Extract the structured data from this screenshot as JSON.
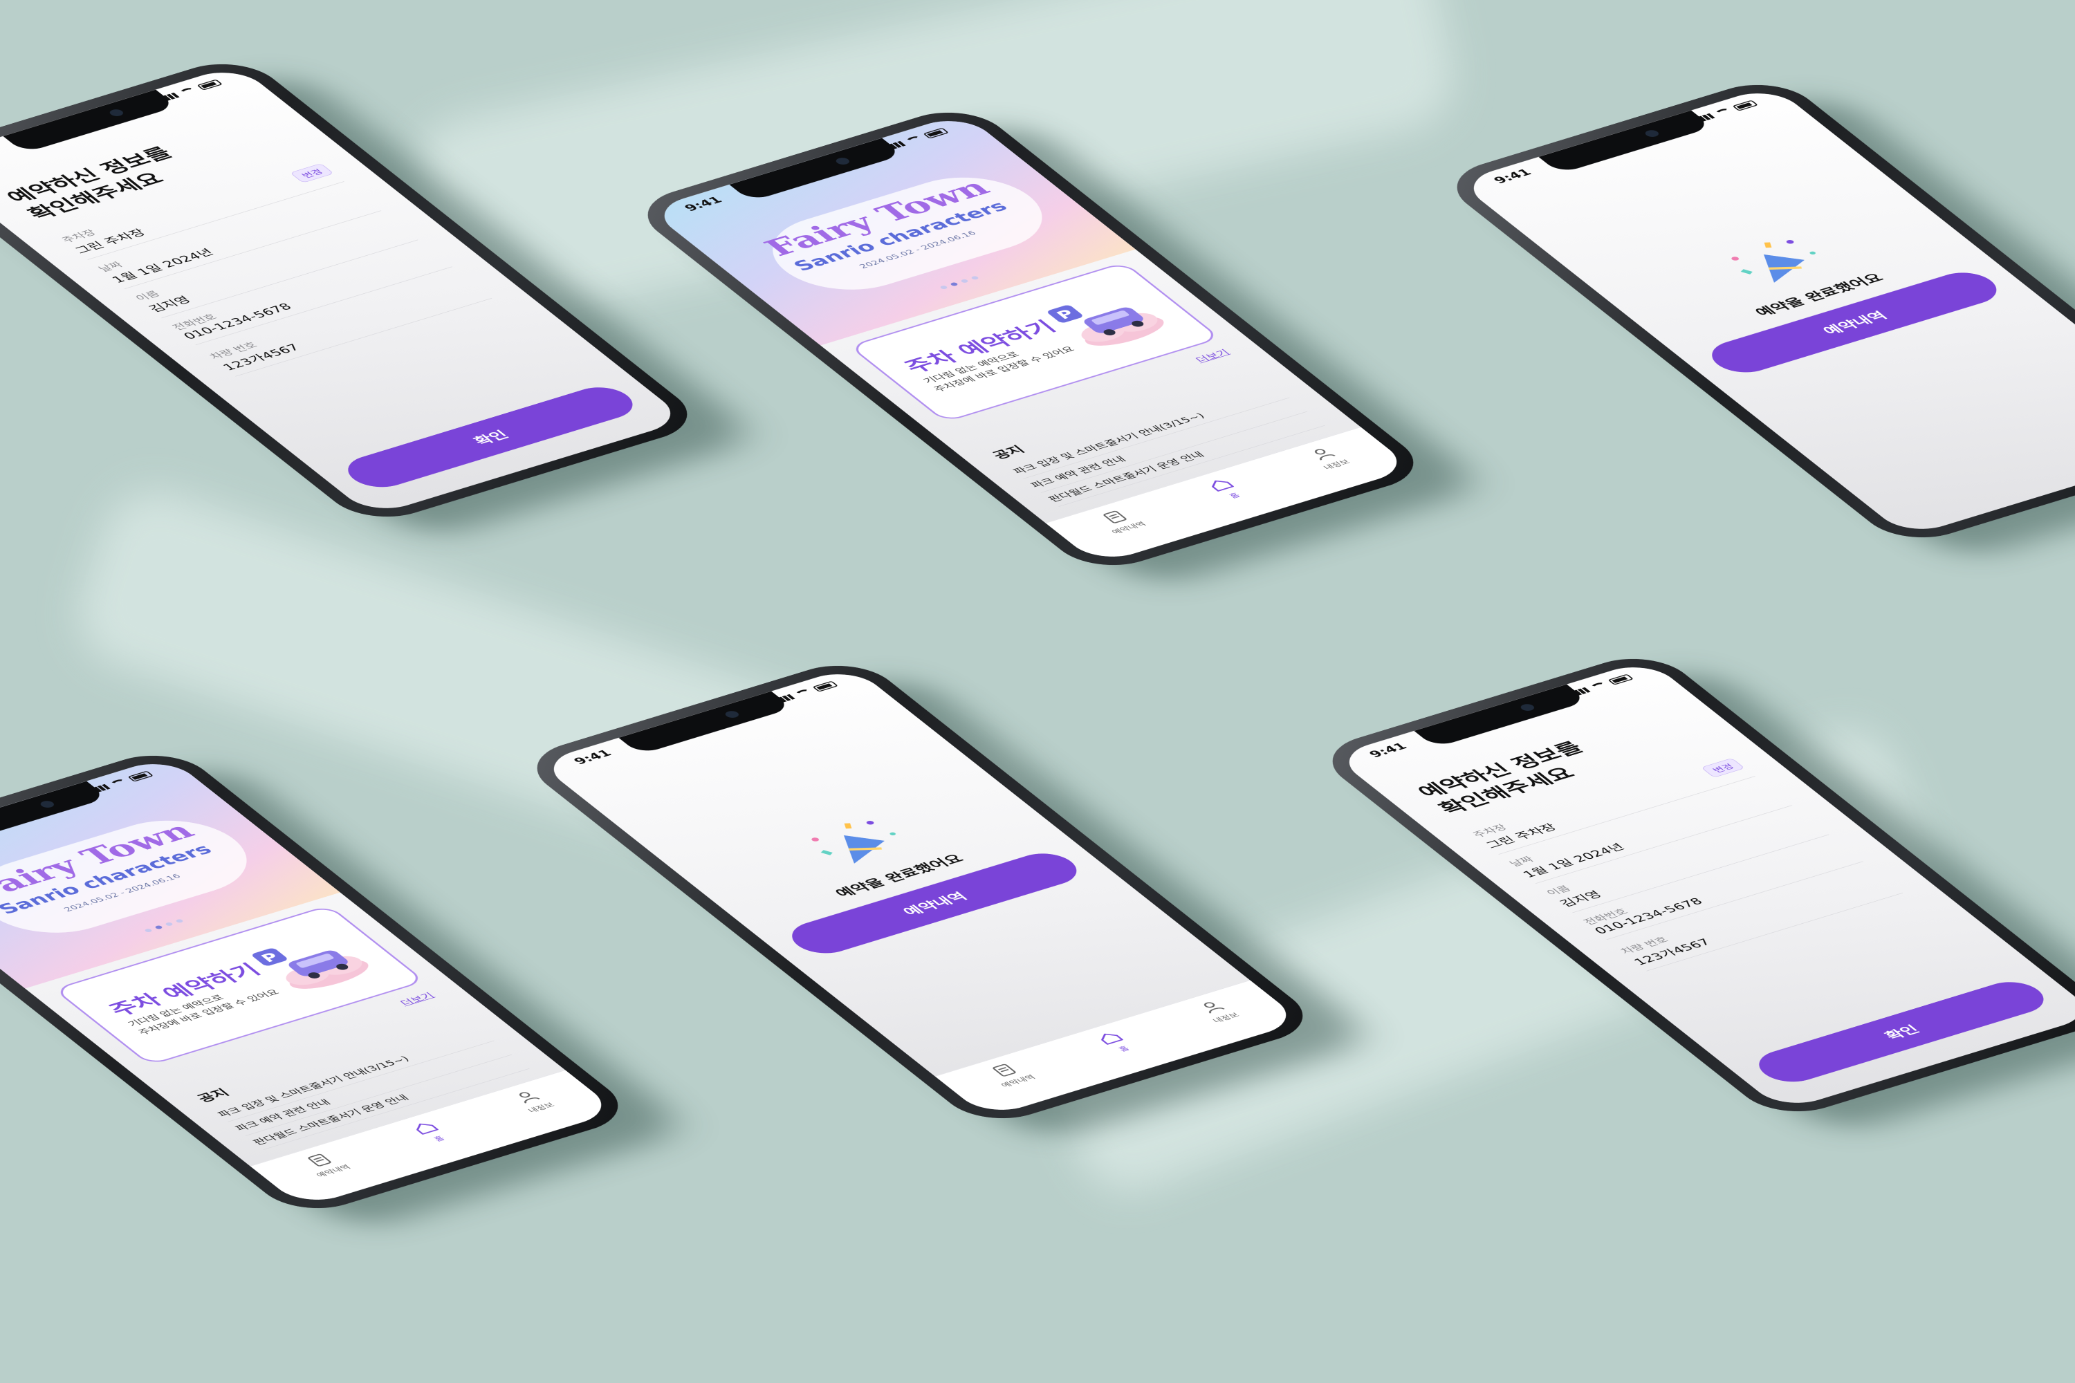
{
  "status_time": "9:41",
  "colors": {
    "accent": "#7a44d8",
    "accent_light": "#ede6ff",
    "background": "#b9cfca"
  },
  "confirm": {
    "title": "예약하신 정보를\n확인해주세요",
    "fields": [
      {
        "label": "주차장",
        "value": "그린 주차장"
      },
      {
        "label": "날짜",
        "value": "1월 1일 2024년"
      },
      {
        "label": "이름",
        "value": "김지영"
      },
      {
        "label": "전화번호",
        "value": "010-1234-5678"
      },
      {
        "label": "차량 번호",
        "value": "123가4567"
      }
    ],
    "edit_label": "변경",
    "confirm_button": "확인"
  },
  "complete": {
    "message": "예약을 완료했어요",
    "button": "예약내역"
  },
  "home": {
    "banner": {
      "title": "Fairy Town",
      "subtitle": "Sanrio characters",
      "date_text": "2024.05.02 - 2024.06.16"
    },
    "reserve_card": {
      "title": "주차 예약하기",
      "description": "기다림 없는 예약으로\n주차장에 바로 입장할 수 있어요"
    },
    "more_link": "더보기",
    "notice_title": "공지",
    "notices": [
      "파크 입장 및 스마트줄서기 안내(3/15~)",
      "파크 예약 관련 안내",
      "판다월드 스마트줄서기 운영 안내"
    ],
    "tabs": [
      {
        "label": "예약내역",
        "icon": "receipt-icon"
      },
      {
        "label": "홈",
        "icon": "home-icon"
      },
      {
        "label": "내정보",
        "icon": "user-icon"
      }
    ]
  }
}
